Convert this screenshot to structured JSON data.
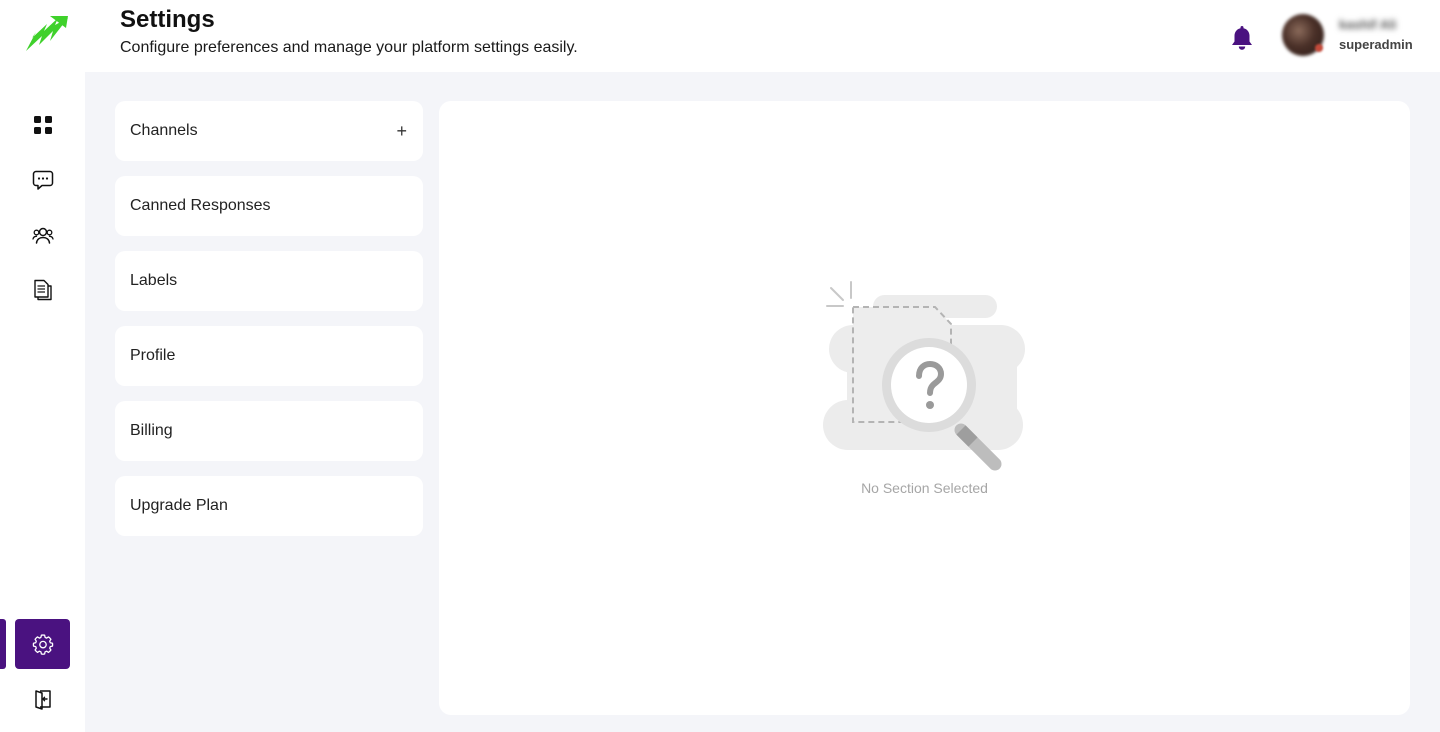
{
  "header": {
    "title": "Settings",
    "subtitle": "Configure preferences and manage your platform settings easily.",
    "user": {
      "name": "kashif Ali",
      "role": "superadmin"
    }
  },
  "sidebar": {
    "items": [
      {
        "icon": "dashboard-grid-icon"
      },
      {
        "icon": "chat-bubble-icon"
      },
      {
        "icon": "users-icon"
      },
      {
        "icon": "document-icon"
      },
      {
        "icon": "gear-icon",
        "active": true
      },
      {
        "icon": "logout-icon"
      }
    ]
  },
  "settings_menu": {
    "items": [
      {
        "label": "Channels",
        "action": "+"
      },
      {
        "label": "Canned Responses"
      },
      {
        "label": "Labels"
      },
      {
        "label": "Profile"
      },
      {
        "label": "Billing"
      },
      {
        "label": "Upgrade Plan"
      }
    ]
  },
  "empty_state": {
    "text": "No Section Selected"
  },
  "colors": {
    "accent": "#4a1280",
    "logo_green": "#3fd12b",
    "background": "#f4f5f9"
  }
}
